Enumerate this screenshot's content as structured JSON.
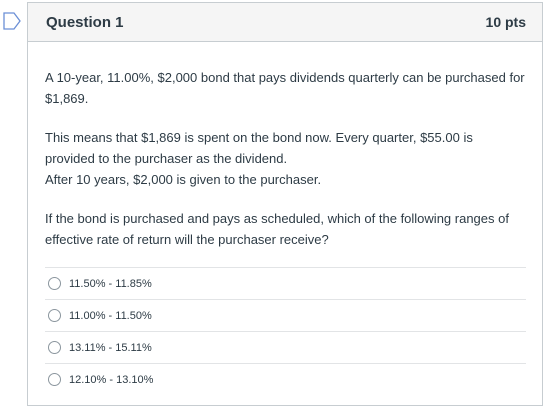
{
  "question": {
    "title": "Question 1",
    "points": "10 pts",
    "paragraph1": "A 10-year, 11.00%, $2,000 bond that pays dividends quarterly can be purchased for $1,869.",
    "paragraph2_line1": "This means that $1,869 is spent on the bond now. Every quarter, $55.00 is provided to the purchaser as the dividend.",
    "paragraph2_line2": "After 10 years, $2,000 is given to the purchaser.",
    "paragraph3": "If the bond is purchased and pays as scheduled, which of the following ranges of effective rate of return will the purchaser receive?"
  },
  "answers": [
    {
      "label": "11.50% - 11.85%",
      "selected": false
    },
    {
      "label": "11.00% - 11.50%",
      "selected": false
    },
    {
      "label": "13.11% - 15.11%",
      "selected": false
    },
    {
      "label": "12.10% - 13.10%",
      "selected": false
    }
  ],
  "icons": {
    "flag": "bookmark-flag-icon"
  },
  "colors": {
    "border": "#c7cdd1",
    "header_bg": "#f5f5f5",
    "text": "#2d3b45",
    "flag": "#6b8fd6"
  }
}
